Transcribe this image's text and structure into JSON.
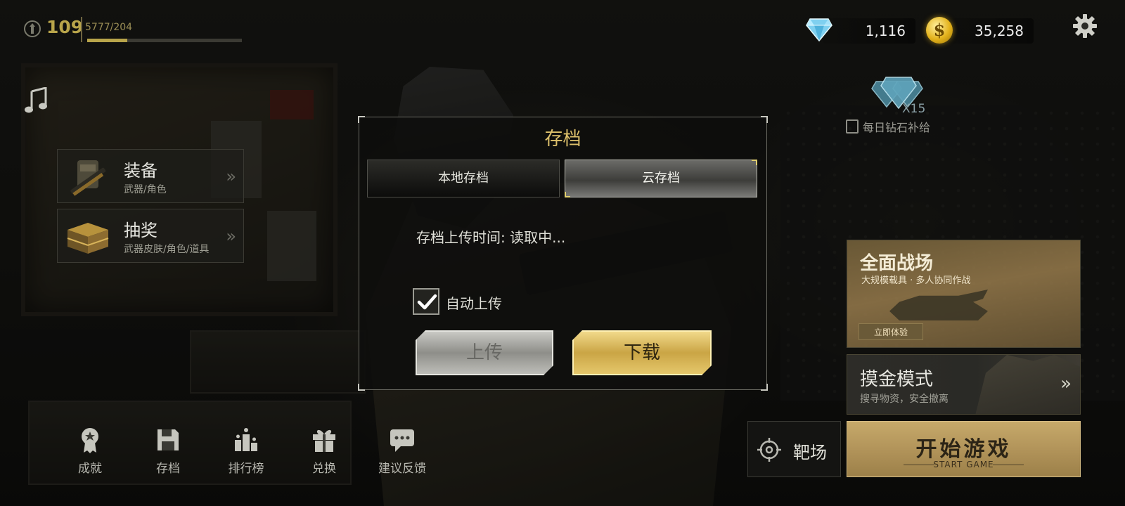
{
  "hud": {
    "level": "109",
    "xp_text": "5777/204",
    "xp_progress": 0.26,
    "gems": "1,116",
    "coins": "35,258",
    "coin_symbol": "$"
  },
  "left_menu": {
    "equipment": {
      "title": "装备",
      "subtitle": "武器/角色"
    },
    "lottery": {
      "title": "抽奖",
      "subtitle": "武器皮肤/角色/道具"
    }
  },
  "daily_reward": {
    "count": "X15",
    "label": "每日钻石补给"
  },
  "banners": {
    "warzone": {
      "title": "全面战场",
      "subtitle": "大规模载具 · 多人协同作战",
      "button": "立即体验"
    },
    "gold_mode": {
      "title": "摸金模式",
      "subtitle": "搜寻物资，安全撤离"
    }
  },
  "range_button": {
    "label": "靶场"
  },
  "start_button": {
    "title": "开始游戏",
    "subtitle": "START GAME"
  },
  "bottom_nav": [
    {
      "label": "成就",
      "icon": "medal-icon"
    },
    {
      "label": "存档",
      "icon": "save-icon"
    },
    {
      "label": "排行榜",
      "icon": "leaderboard-icon"
    },
    {
      "label": "兑换",
      "icon": "gift-icon"
    },
    {
      "label": "建议反馈",
      "icon": "chat-icon"
    }
  ],
  "modal": {
    "title": "存档",
    "tabs": {
      "local": "本地存档",
      "cloud": "云存档",
      "active": "cloud"
    },
    "upload_time_label": "存档上传时间: ",
    "upload_time_value": "读取中...",
    "auto_upload_label": "自动上传",
    "auto_upload_checked": true,
    "upload_button": "上传",
    "download_button": "下载"
  },
  "colors": {
    "accent_gold": "#dcc06b",
    "level_gold": "#b8a44a",
    "start_button": "#b2945a"
  }
}
